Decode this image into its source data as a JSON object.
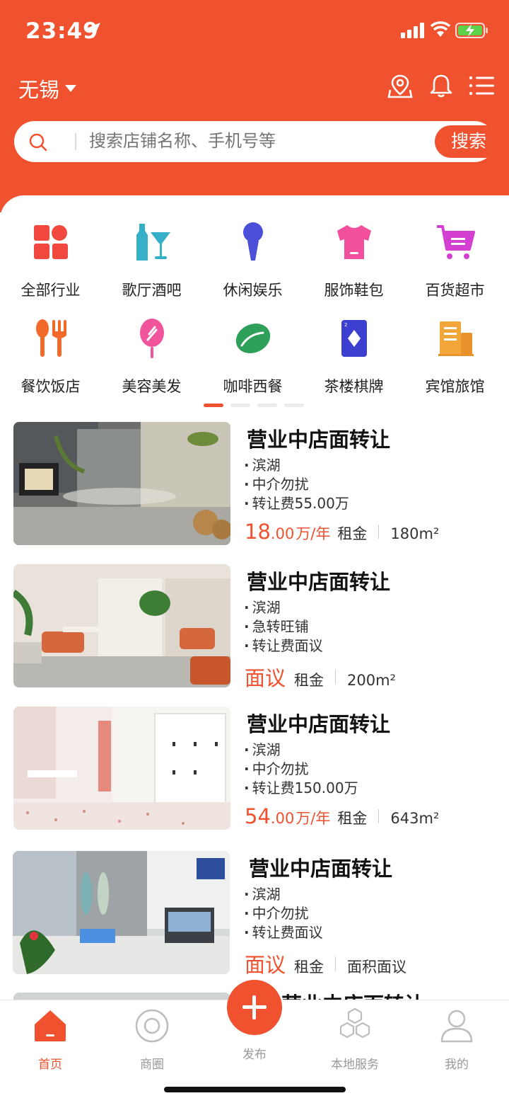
{
  "status": {
    "time": "23:49"
  },
  "header": {
    "city": "无锡"
  },
  "search": {
    "placeholder": "搜索店铺名称、手机号等",
    "button": "搜索"
  },
  "categories": [
    {
      "label": "全部行业",
      "icon": "grid-icon"
    },
    {
      "label": "歌厅酒吧",
      "icon": "bar-drinks-icon"
    },
    {
      "label": "休闲娱乐",
      "icon": "microphone-icon"
    },
    {
      "label": "服饰鞋包",
      "icon": "tshirt-icon"
    },
    {
      "label": "百货超市",
      "icon": "shopping-cart-icon"
    },
    {
      "label": "餐饮饭店",
      "icon": "fork-spoon-icon"
    },
    {
      "label": "美容美发",
      "icon": "beauty-brush-icon"
    },
    {
      "label": "咖啡西餐",
      "icon": "coffee-bean-icon"
    },
    {
      "label": "茶楼棋牌",
      "icon": "playing-card-icon"
    },
    {
      "label": "宾馆旅馆",
      "icon": "hotel-building-icon"
    }
  ],
  "listings": [
    {
      "title": "营业中店面转让",
      "tags": [
        "滨湖",
        "中介勿扰",
        "转让费55.00万"
      ],
      "price_int": "18",
      "price_dec": ".00",
      "price_unit": "万/年",
      "rent_label": "租金",
      "area": "180m²"
    },
    {
      "title": "营业中店面转让",
      "tags": [
        "滨湖",
        "急转旺铺",
        "转让费面议"
      ],
      "price_int": "面议",
      "price_dec": "",
      "price_unit": "",
      "rent_label": "租金",
      "area": "200m²"
    },
    {
      "title": "营业中店面转让",
      "tags": [
        "滨湖",
        "中介勿扰",
        "转让费150.00万"
      ],
      "price_int": "54",
      "price_dec": ".00",
      "price_unit": "万/年",
      "rent_label": "租金",
      "area": "643m²"
    },
    {
      "title": "营业中店面转让",
      "tags": [
        "滨湖",
        "中介勿扰",
        "转让费面议"
      ],
      "price_int": "面议",
      "price_dec": "",
      "price_unit": "",
      "rent_label": "租金",
      "area": "面积面议"
    }
  ],
  "peek_title": "营业中店面转让",
  "tabbar": {
    "home": "首页",
    "circle": "商圈",
    "publish": "发布",
    "local": "本地服务",
    "mine": "我的"
  },
  "colors": {
    "accent": "#f0512e"
  }
}
